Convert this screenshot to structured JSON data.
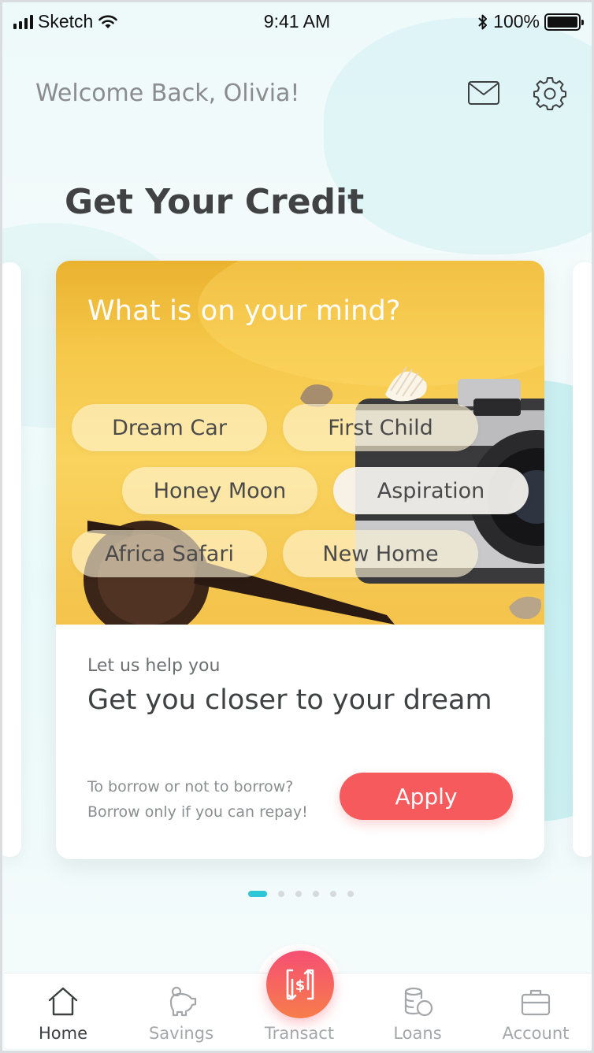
{
  "status_bar": {
    "carrier": "Sketch",
    "time": "9:41 AM",
    "battery": "100%",
    "battery_level": 1.0,
    "signal_bars": 4,
    "icons": [
      "signal-icon",
      "wifi-icon",
      "bluetooth-icon",
      "battery-icon"
    ]
  },
  "header": {
    "welcome": "Welcome Back, Olivia!",
    "icons": [
      "mail-icon",
      "gear-icon"
    ]
  },
  "page": {
    "title": "Get Your Credit"
  },
  "card": {
    "question": "What is on your mind?",
    "chips": [
      {
        "label": "Dream Car",
        "selected": false
      },
      {
        "label": "First Child",
        "selected": false
      },
      {
        "label": "Honey Moon",
        "selected": false
      },
      {
        "label": "Aspiration",
        "selected": true
      },
      {
        "label": "Africa Safari",
        "selected": false
      },
      {
        "label": "New Home",
        "selected": false
      }
    ],
    "subtitle": "Let us help you",
    "headline": "Get you closer to your dream",
    "note_line1": "To borrow or not to borrow?",
    "note_line2": "Borrow only if you can repay!",
    "apply_label": "Apply"
  },
  "pager": {
    "total": 6,
    "active_index": 0
  },
  "tabbar": {
    "tabs": [
      {
        "label": "Home",
        "icon": "home-icon",
        "active": true
      },
      {
        "label": "Savings",
        "icon": "piggy-bank-icon",
        "active": false
      },
      {
        "label": "Transact",
        "icon": "transfer-icon",
        "active": false
      },
      {
        "label": "Loans",
        "icon": "coins-icon",
        "active": false
      },
      {
        "label": "Account",
        "icon": "briefcase-icon",
        "active": false
      }
    ]
  },
  "colors": {
    "accent": "#2ec6d6",
    "apply": "#f75a5d",
    "hero_yellow": "#f6c84a",
    "text_dark": "#404244",
    "text_muted": "#8a8c8e"
  }
}
